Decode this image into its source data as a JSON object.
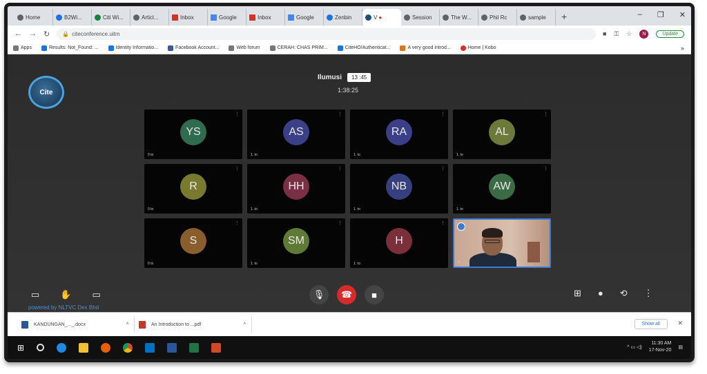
{
  "browser": {
    "tabs": [
      {
        "label": "Home",
        "icon": "gear"
      },
      {
        "label": "B2Wi...",
        "icon": "blue"
      },
      {
        "label": "Citi Wi...",
        "icon": "green"
      },
      {
        "label": "Articl...",
        "icon": "gear"
      },
      {
        "label": "Inbox",
        "icon": "gmail"
      },
      {
        "label": "Google",
        "icon": "doc"
      },
      {
        "label": "Inbox",
        "icon": "gmail"
      },
      {
        "label": "Google",
        "icon": "doc"
      },
      {
        "label": "Zenbin",
        "icon": "blue"
      },
      {
        "label": "V",
        "icon": "cite",
        "active": true,
        "recording": "●"
      },
      {
        "label": "Session",
        "icon": "gear"
      },
      {
        "label": "The W...",
        "icon": "gear"
      },
      {
        "label": "Phil Rc",
        "icon": "gear"
      },
      {
        "label": "sample",
        "icon": "gear"
      }
    ],
    "new_tab": "+",
    "window_controls": [
      "–",
      "❐",
      "✕"
    ],
    "address": "citeconference.uitm",
    "update_label": "Update",
    "avatar_initial": "N",
    "bookmarks": [
      {
        "label": "Apps",
        "icon": "grey"
      },
      {
        "label": "Results: Not_Found: ...",
        "icon": "blue"
      },
      {
        "label": "Identity Informatio...",
        "icon": "blue"
      },
      {
        "label": "Facebook Account...",
        "icon": "fb"
      },
      {
        "label": "Web forum",
        "icon": "grey"
      },
      {
        "label": "CERAH: CHAS PRIM...",
        "icon": "grey"
      },
      {
        "label": "CiteHO/Authenticat...",
        "icon": "blue"
      },
      {
        "label": "A very good introd...",
        "icon": "orange"
      },
      {
        "label": "Home | Kobo",
        "icon": "red"
      }
    ],
    "bookmarks_more": "»"
  },
  "meeting": {
    "logo_text": "Cite",
    "room_name": "Ilumusi",
    "room_badge": "13 :45",
    "timer": "1:38:25",
    "participants": [
      {
        "initials": "YS",
        "color": "#2f6b4f",
        "label": "0 to"
      },
      {
        "initials": "AS",
        "color": "#3b3f86",
        "label": "1. to"
      },
      {
        "initials": "RA",
        "color": "#3a3f88",
        "label": "1. to"
      },
      {
        "initials": "AL",
        "color": "#6b7a3a",
        "label": "1. to"
      },
      {
        "initials": "R",
        "color": "#7a7a2e",
        "label": "0 to"
      },
      {
        "initials": "HH",
        "color": "#7a2f44",
        "label": "1. to"
      },
      {
        "initials": "NB",
        "color": "#37407f",
        "label": "1. to"
      },
      {
        "initials": "AW",
        "color": "#3b6b45",
        "label": "1. to"
      },
      {
        "initials": "S",
        "color": "#8a5e2c",
        "label": "0 to"
      },
      {
        "initials": "SM",
        "color": "#5e7a35",
        "label": "1. to"
      },
      {
        "initials": "H",
        "color": "#7a2f3a",
        "label": "1. to"
      }
    ],
    "video_tile_label": "0",
    "tile_menu": "⋮",
    "powered_by": "powered by NLTVC Dex Bhd",
    "controls_left": [
      "▭",
      "✋",
      "▭"
    ],
    "controls_right": [
      "⊞",
      "●",
      "⟲",
      "⋮"
    ],
    "mic_icon": "🎙",
    "hangup_icon": "☎",
    "camera_icon": "■"
  },
  "downloads": {
    "items": [
      {
        "name": "KANDUNGAN_..._.docx",
        "icon": "word"
      },
      {
        "name": "An Introduction to ...pdf",
        "icon": "pdf"
      }
    ],
    "chevron": "^",
    "show_all": "Show all",
    "close": "✕"
  },
  "taskbar": {
    "start": "⊞",
    "time": "11:30 AM",
    "date": "17-Nov-20",
    "tray_icons": "^ ▭ ◁)",
    "notifications": "▤"
  }
}
